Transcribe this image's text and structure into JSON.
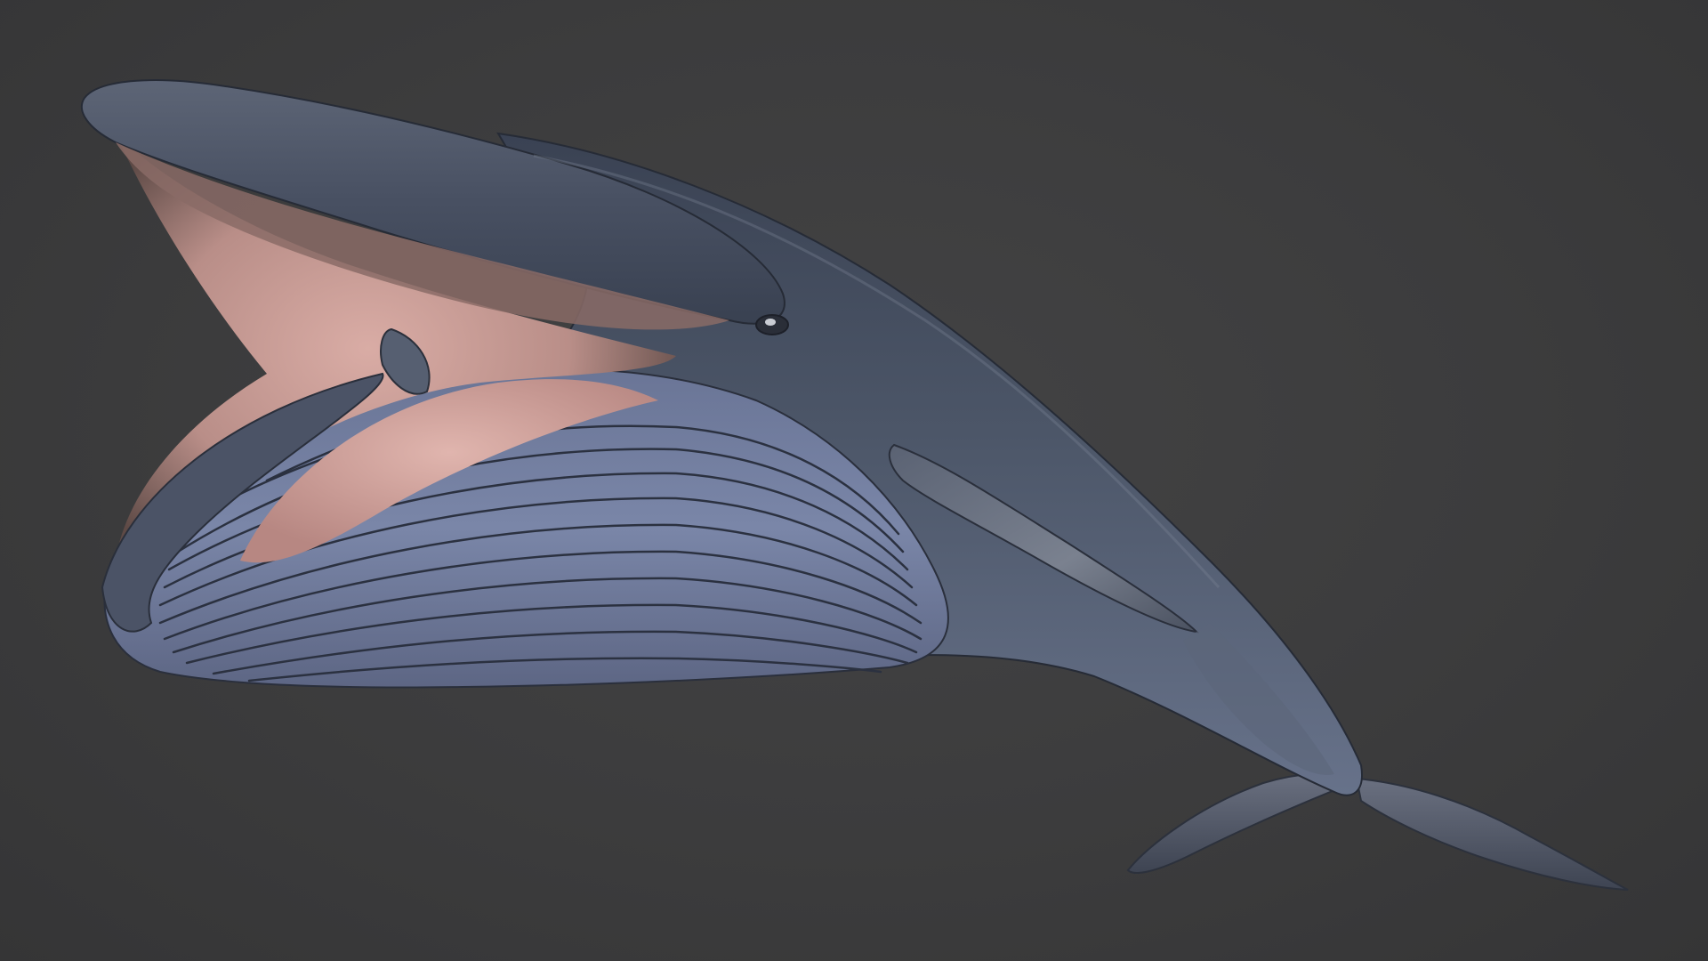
{
  "scene": {
    "subject": "whale-render",
    "colors": {
      "background": "#3d3d3e",
      "body_dark": "#2f3645",
      "body_mid": "#4d5668",
      "body_light": "#6f7a90",
      "throat_grooves": "#7c87a6",
      "groove_lines": "#2a2f3c",
      "mouth_interior": "#c99a94",
      "tongue": "#d8aaa3",
      "mouth_shadow": "#5a4642"
    }
  }
}
